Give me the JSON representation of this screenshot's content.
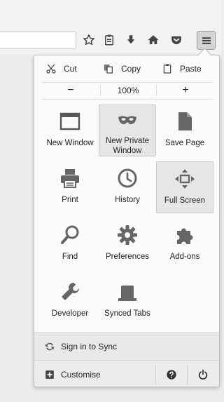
{
  "toolbar": {
    "icons": [
      "bookmark-star-icon",
      "reading-list-icon",
      "downloads-icon",
      "home-icon",
      "pocket-icon",
      "menu-hamburger-icon"
    ]
  },
  "edit": {
    "cut": "Cut",
    "copy": "Copy",
    "paste": "Paste"
  },
  "zoom": {
    "out": "−",
    "level": "100%",
    "in": "+"
  },
  "tiles": [
    {
      "label": "New Window",
      "icon": "new-window-icon"
    },
    {
      "label": "New Private Window",
      "icon": "private-mask-icon"
    },
    {
      "label": "Save Page",
      "icon": "save-page-icon"
    },
    {
      "label": "Print",
      "icon": "printer-icon"
    },
    {
      "label": "History",
      "icon": "history-clock-icon"
    },
    {
      "label": "Full Screen",
      "icon": "full-screen-icon"
    },
    {
      "label": "Find",
      "icon": "magnifier-icon"
    },
    {
      "label": "Preferences",
      "icon": "gear-icon"
    },
    {
      "label": "Add-ons",
      "icon": "puzzle-piece-icon"
    },
    {
      "label": "Developer",
      "icon": "wrench-icon"
    },
    {
      "label": "Synced Tabs",
      "icon": "synced-tabs-icon"
    }
  ],
  "sync": {
    "label": "Sign in to Sync"
  },
  "footer": {
    "customise": "Customise",
    "help_icon": "help-icon",
    "quit_icon": "power-icon"
  },
  "colors": {
    "icon": "#555555",
    "panel_bg": "#fbfbfb",
    "active_tile": "#e6e6e6"
  }
}
